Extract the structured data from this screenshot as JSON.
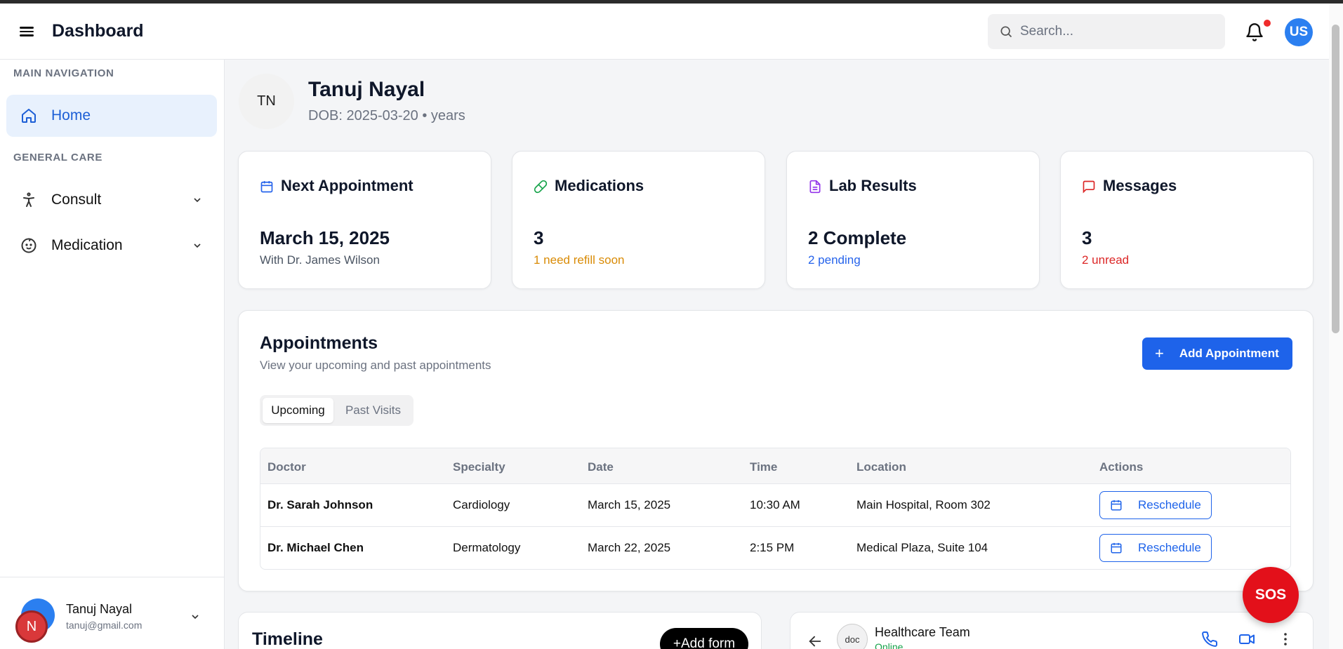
{
  "header": {
    "title": "Dashboard",
    "search_placeholder": "Search...",
    "avatar_initials": "US"
  },
  "sidebar": {
    "main_nav_label": "MAIN NAVIGATION",
    "general_care_label": "GENERAL CARE",
    "items": [
      {
        "label": "Home"
      },
      {
        "label": "Consult"
      },
      {
        "label": "Medication"
      }
    ],
    "user": {
      "name": "Tanuj Nayal",
      "email": "tanuj@gmail.com",
      "badge": "N"
    }
  },
  "profile": {
    "initials": "TN",
    "name": "Tanuj Nayal",
    "dob": "DOB: 2025-03-20 • years"
  },
  "cards": [
    {
      "title": "Next Appointment",
      "value": "March 15, 2025",
      "sub": "With Dr. James Wilson",
      "sub_color": "#4b5563",
      "icon_color": "#2563eb"
    },
    {
      "title": "Medications",
      "value": "3",
      "sub": "1 need refill soon",
      "sub_color": "#d98b06",
      "icon_color": "#16a34a"
    },
    {
      "title": "Lab Results",
      "value": "2 Complete",
      "sub": "2 pending",
      "sub_color": "#2563eb",
      "icon_color": "#9333ea"
    },
    {
      "title": "Messages",
      "value": "3",
      "sub": "2 unread",
      "sub_color": "#dc2626",
      "icon_color": "#dc2626"
    }
  ],
  "appointments": {
    "title": "Appointments",
    "subtitle": "View your upcoming and past appointments",
    "add_label": "Add Appointment",
    "tabs": [
      "Upcoming",
      "Past Visits"
    ],
    "columns": [
      "Doctor",
      "Specialty",
      "Date",
      "Time",
      "Location",
      "Actions"
    ],
    "rows": [
      {
        "doctor": "Dr. Sarah Johnson",
        "specialty": "Cardiology",
        "date": "March 15, 2025",
        "time": "10:30 AM",
        "location": "Main Hospital, Room 302",
        "action": "Reschedule"
      },
      {
        "doctor": "Dr. Michael Chen",
        "specialty": "Dermatology",
        "date": "March 22, 2025",
        "time": "2:15 PM",
        "location": "Medical Plaza, Suite 104",
        "action": "Reschedule"
      }
    ]
  },
  "sos_label": "SOS",
  "timeline": {
    "title": "Timeline",
    "add_form_label": "+Add form"
  },
  "chat": {
    "name": "Healthcare Team",
    "status": "Online",
    "avatar_alt": "doc"
  }
}
